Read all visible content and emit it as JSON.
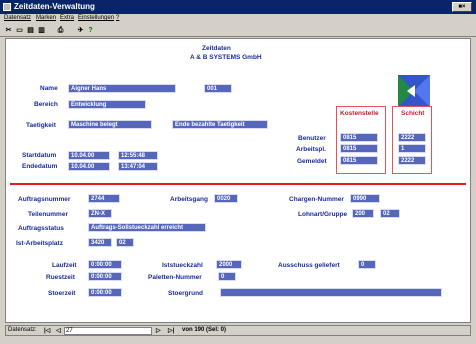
{
  "window": {
    "title": "Zeitdaten-Verwaltung",
    "controls": "■×"
  },
  "menu": [
    "Datensatz",
    "Marken",
    "Extra",
    "Einstellungen",
    "?"
  ],
  "toolbar": {
    "buttons": [
      "✂",
      "▭",
      "▤",
      "▥",
      "⎙",
      "✈",
      "?"
    ]
  },
  "header": {
    "line1": "Zeitdaten",
    "line2": "A & B SYSTEMS GmbH"
  },
  "person": {
    "name_label": "Name",
    "name_value": "Aigner Hans",
    "id_value": "001",
    "bereich_label": "Bereich",
    "bereich_value": "Entwicklung",
    "taetigkeit_label": "Taetigkeit",
    "taetigkeit_value": "Maschine belegt",
    "taetigkeit_extra": "Ende bezahlte Taetigkeit"
  },
  "kostenstelle": {
    "title": "Kostenstelle",
    "benutzer_label": "Benutzer",
    "benutzer_value": "0815",
    "arbeitspl_label": "Arbeitspl.",
    "arbeitspl_value": "0815",
    "gemeldet_label": "Gemeldet",
    "gemeldet_value": "0815"
  },
  "schicht": {
    "title": "Schicht",
    "values": [
      "2222",
      "1",
      "2222"
    ]
  },
  "dates": {
    "start_label": "Startdatum",
    "start_date": "10.04.00",
    "start_time": "12:55:48",
    "end_label": "Endedatum",
    "end_date": "10.04.00",
    "end_time": "13:47:04"
  },
  "auftrag": {
    "nummer_label": "Auftragsnummer",
    "nummer_value": "2744",
    "arbeitsgang_label": "Arbeitsgang",
    "arbeitsgang_value": "0020",
    "chargen_label": "Chargen-Nummer",
    "chargen_value": "0990",
    "teil_label": "Teilenummer",
    "teil_value": "ZN-X",
    "lohnart_label": "Lohnart/Gruppe",
    "lohnart_value1": "200",
    "lohnart_value2": "02",
    "status_label": "Auftragsstatus",
    "status_value": "Auftrags-Sollstueckzahl erreicht",
    "platz_label": "Ist-Arbeitsplatz",
    "platz_value1": "3420",
    "platz_value2": "02"
  },
  "zeiten": {
    "laufzeit_label": "Laufzeit",
    "laufzeit_value": "0:00:00",
    "ruestzeit_label": "Ruestzeit",
    "ruestzeit_value": "0:00:00",
    "stoerzeit_label": "Stoerzeit",
    "stoerzeit_value": "0:00:00",
    "ist_label": "Iststueckzahl",
    "ist_value": "2000",
    "paletten_label": "Paletten-Nummer",
    "paletten_value": "0",
    "stoergrund_label": "Stoergrund",
    "stoergrund_value": "",
    "ausschuss_label": "Ausschuss geliefert",
    "ausschuss_value": "0"
  },
  "status": {
    "label": "Datensatz:",
    "first": "|◁",
    "prev": "◁",
    "record": "27",
    "next": "▷",
    "last": "▷|",
    "info": "von 190 (Sel: 0)"
  }
}
